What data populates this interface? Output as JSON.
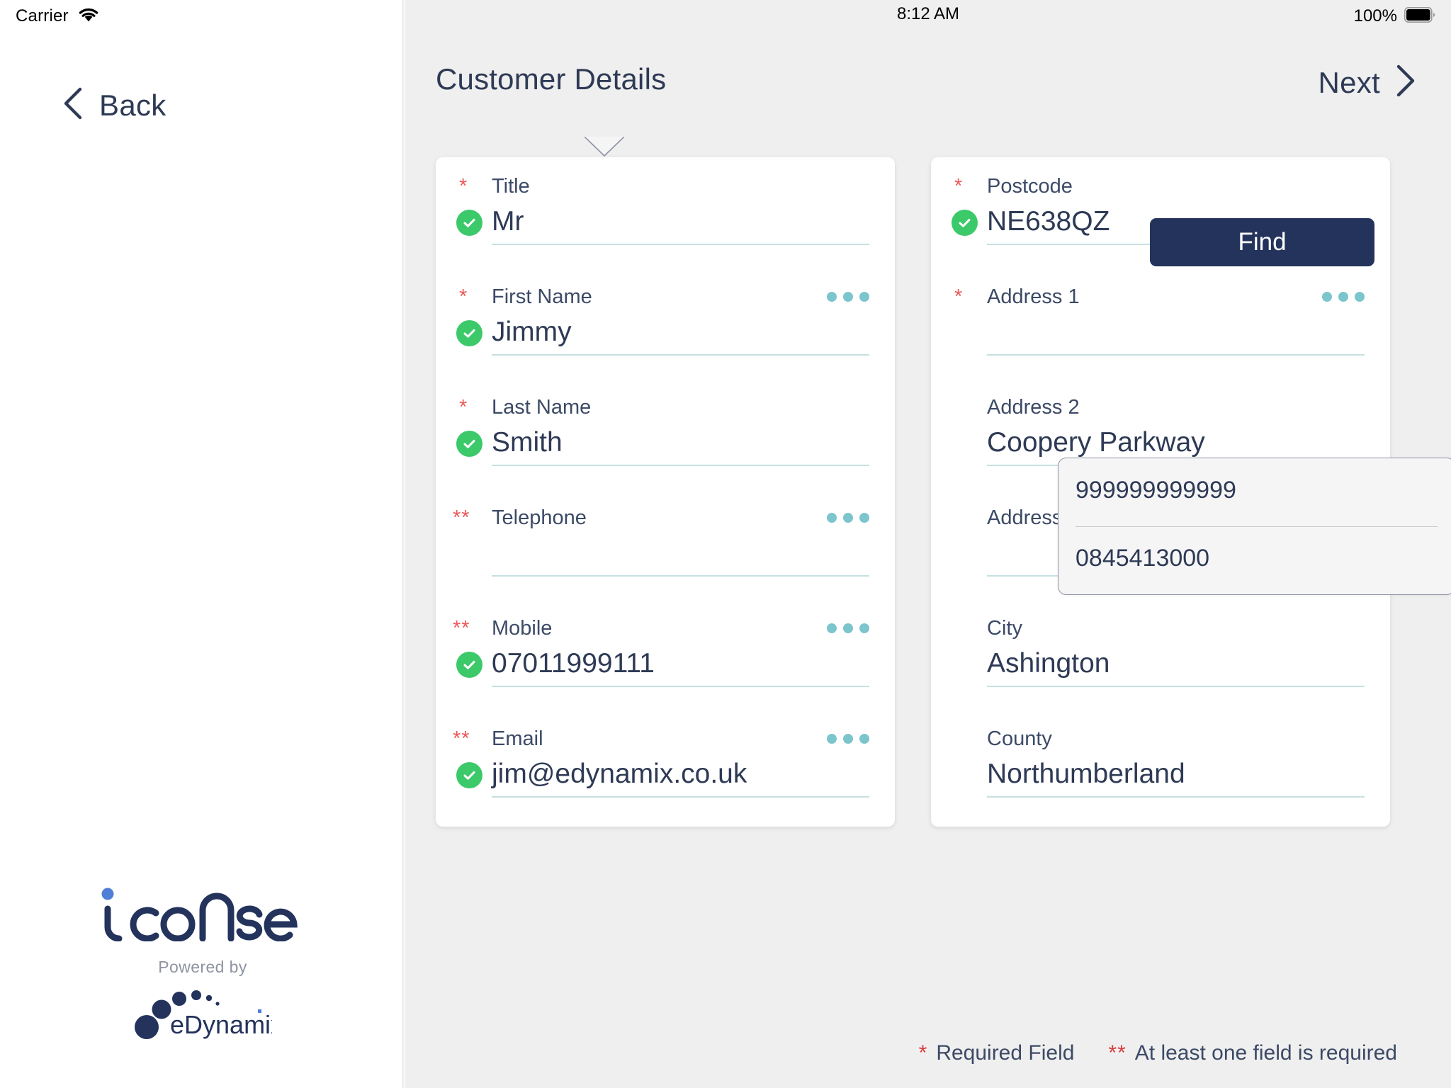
{
  "statusbar": {
    "carrier": "Carrier",
    "wifi_icon": "wifi-icon",
    "time": "8:12 AM",
    "battery_percent": "100%",
    "battery_icon": "battery-full-icon"
  },
  "sidebar": {
    "back_label": "Back",
    "back_icon": "chevron-left-icon",
    "logo_text": "iconsent",
    "powered_by": "Powered by",
    "partner_logo_text": "eDynamix"
  },
  "header": {
    "title": "Customer Details",
    "next_label": "Next",
    "next_icon": "chevron-right-icon"
  },
  "left_card": {
    "fields": [
      {
        "label": "Title",
        "required_mark": "*",
        "value": "Mr",
        "valid": true,
        "has_dots": false
      },
      {
        "label": "First Name",
        "required_mark": "*",
        "value": "Jimmy",
        "valid": true,
        "has_dots": true
      },
      {
        "label": "Last Name",
        "required_mark": "*",
        "value": "Smith",
        "valid": true,
        "has_dots": false
      },
      {
        "label": "Telephone",
        "required_mark": "**",
        "value": "",
        "valid": false,
        "has_dots": true
      },
      {
        "label": "Mobile",
        "required_mark": "**",
        "value": "07011999111",
        "valid": true,
        "has_dots": true
      },
      {
        "label": "Email",
        "required_mark": "**",
        "value": "jim@edynamix.co.uk",
        "valid": true,
        "has_dots": true
      }
    ]
  },
  "right_card": {
    "find_button_label": "Find",
    "fields": [
      {
        "label": "Postcode",
        "required_mark": "*",
        "value": "NE638QZ",
        "valid": true,
        "has_dots": false
      },
      {
        "label": "Address 1",
        "required_mark": "*",
        "value": "",
        "valid": false,
        "has_dots": true
      },
      {
        "label": "Address 2",
        "required_mark": "",
        "value": "Coopery Parkway",
        "valid": false,
        "has_dots": false
      },
      {
        "label": "Address 3",
        "required_mark": "",
        "value": "",
        "valid": false,
        "has_dots": false
      },
      {
        "label": "City",
        "required_mark": "",
        "value": "Ashington",
        "valid": false,
        "has_dots": false
      },
      {
        "label": "County",
        "required_mark": "",
        "value": "Northumberland",
        "valid": false,
        "has_dots": false
      }
    ]
  },
  "popover": {
    "options": [
      "999999999999",
      "0845413000"
    ]
  },
  "legend": {
    "required_mark": "*",
    "required_text": "Required Field",
    "atleast_mark": "**",
    "atleast_text": "At least one field is required"
  },
  "colors": {
    "accent_navy": "#24335c",
    "text_navy": "#2e3a55",
    "valid_green": "#3cc96a",
    "required_red": "#ec5a57",
    "underline_teal": "#c6e0e2",
    "dots_teal": "#7cc5cd",
    "pane_bg": "#efefef"
  }
}
